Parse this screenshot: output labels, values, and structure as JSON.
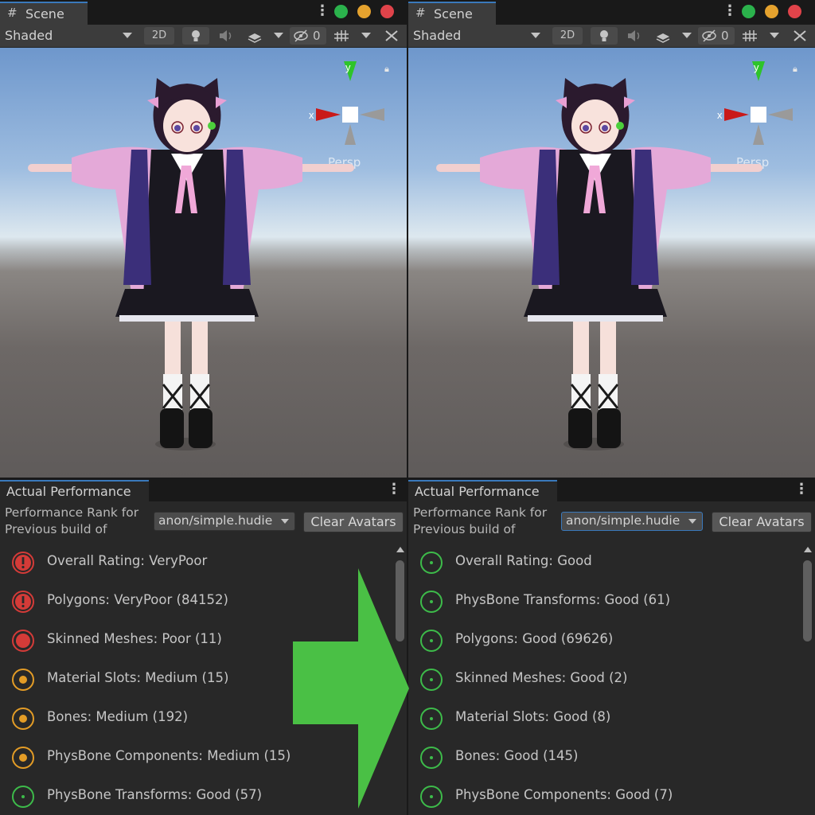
{
  "colors": {
    "accent": "#3a79bb",
    "very_poor": "#d43b38",
    "poor": "#d43b38",
    "medium": "#e39c26",
    "good": "#3dbb4a",
    "comparison_arrow": "#4ac045",
    "dot_green": "#2bb24c",
    "dot_yellow": "#e5a22e",
    "dot_red": "#e0434a"
  },
  "panes": [
    {
      "scene_tab": {
        "label": "Scene",
        "icon": "hash-grid-icon"
      },
      "toolbar": {
        "shading_mode": "Shaded",
        "mode_2d": "2D",
        "hidden_count": "0"
      },
      "viewport": {
        "gizmo_x": "x",
        "gizmo_y": "y",
        "projection": "Persp"
      },
      "perf": {
        "tab_label": "Actual Performance",
        "rank_label": "Performance Rank for Previous build of",
        "avatar_select": "anon/simple.hudie",
        "clear_button": "Clear Avatars",
        "rows": [
          {
            "text": "Overall Rating: VeryPoor",
            "rating": "very_poor",
            "icon": "exclamation-circle-icon"
          },
          {
            "text": "Polygons: VeryPoor (84152)",
            "rating": "very_poor",
            "icon": "exclamation-circle-icon"
          },
          {
            "text": "Skinned Meshes: Poor (11)",
            "rating": "poor",
            "icon": "filled-circle-icon"
          },
          {
            "text": "Material Slots: Medium (15)",
            "rating": "medium",
            "icon": "ring-dot-icon"
          },
          {
            "text": "Bones: Medium (192)",
            "rating": "medium",
            "icon": "ring-dot-icon"
          },
          {
            "text": "PhysBone Components: Medium (15)",
            "rating": "medium",
            "icon": "ring-dot-icon"
          },
          {
            "text": "PhysBone Transforms: Good (57)",
            "rating": "good",
            "icon": "ring-dot-icon"
          }
        ]
      }
    },
    {
      "scene_tab": {
        "label": "Scene",
        "icon": "hash-grid-icon"
      },
      "toolbar": {
        "shading_mode": "Shaded",
        "mode_2d": "2D",
        "hidden_count": "0"
      },
      "viewport": {
        "gizmo_x": "x",
        "gizmo_y": "y",
        "projection": "Persp"
      },
      "perf": {
        "tab_label": "Actual Performance",
        "rank_label": "Performance Rank for Previous build of",
        "avatar_select": "anon/simple.hudie",
        "clear_button": "Clear Avatars",
        "rows": [
          {
            "text": "Overall Rating: Good",
            "rating": "good",
            "icon": "ring-dot-icon"
          },
          {
            "text": "PhysBone Transforms: Good (61)",
            "rating": "good",
            "icon": "ring-dot-icon"
          },
          {
            "text": "Polygons: Good (69626)",
            "rating": "good",
            "icon": "ring-dot-icon"
          },
          {
            "text": "Skinned Meshes: Good (2)",
            "rating": "good",
            "icon": "ring-dot-icon"
          },
          {
            "text": "Material Slots: Good (8)",
            "rating": "good",
            "icon": "ring-dot-icon"
          },
          {
            "text": "Bones: Good (145)",
            "rating": "good",
            "icon": "ring-dot-icon"
          },
          {
            "text": "PhysBone Components: Good (7)",
            "rating": "good",
            "icon": "ring-dot-icon"
          }
        ]
      }
    }
  ]
}
